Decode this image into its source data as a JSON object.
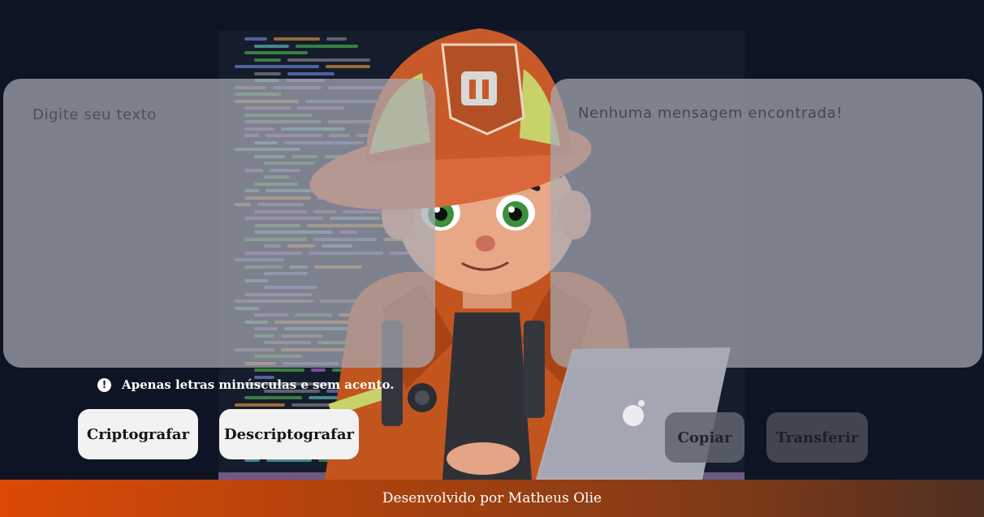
{
  "input_panel": {
    "placeholder": "Digite seu texto"
  },
  "output_panel": {
    "message": "Nenhuma mensagem encontrada!"
  },
  "hint": {
    "icon": "info-icon",
    "icon_glyph": "!",
    "text": "Apenas letras minúsculas e sem acento."
  },
  "buttons": {
    "encrypt_label": "Criptografar",
    "decrypt_label": "Descriptografar",
    "copy_label": "Copiar",
    "transfer_label": "Transferir"
  },
  "footer": {
    "text": "Desenvolvido por Matheus Olie"
  },
  "colors": {
    "page_background": "#0e1424",
    "panel_glass": "#a8aab4",
    "primary_button": "#f2f2f3",
    "footer_gradient_start": "#dc4a05",
    "footer_gradient_end": "#4f2f22"
  }
}
